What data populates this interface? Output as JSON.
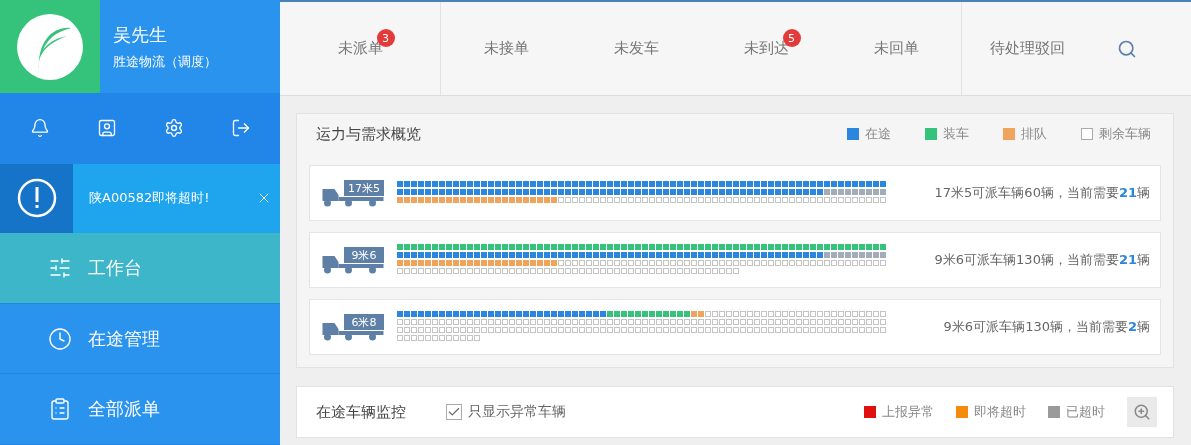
{
  "user": {
    "name": "吴先生",
    "company": "胜途物流（调度）"
  },
  "toolbar_icons": [
    {
      "kind": "bell"
    },
    {
      "kind": "contact"
    },
    {
      "kind": "settings"
    },
    {
      "kind": "logout"
    }
  ],
  "alert": {
    "text": "陕A00582即将超时!"
  },
  "menu": [
    {
      "label": "工作台",
      "selected": true
    },
    {
      "label": "在途管理",
      "selected": false
    },
    {
      "label": "全部派单",
      "selected": false
    }
  ],
  "tabs": [
    {
      "label": "未派单",
      "badge": "3"
    },
    {
      "label": "未接单"
    },
    {
      "label": "未发车"
    },
    {
      "label": "未到达",
      "badge": "5"
    },
    {
      "label": "未回单"
    },
    {
      "label": "待处理驳回"
    }
  ],
  "overview": {
    "title": "运力与需求概览",
    "legend": [
      {
        "label": "在途",
        "kind": "filled",
        "color": "#2a86de"
      },
      {
        "label": "装车",
        "kind": "filled",
        "color": "#35c27a"
      },
      {
        "label": "排队",
        "kind": "filled",
        "color": "#f0a35a"
      },
      {
        "label": "剩余车辆",
        "kind": "empty"
      }
    ],
    "rows": [
      {
        "truck": "17米5",
        "summary": "17米5可派车辆60辆，当前需要**21**辆"
      },
      {
        "truck": "9米6",
        "summary": "9米6可派车辆130辆，当前需要**21**辆"
      },
      {
        "truck": "6米8",
        "summary": "9米6可派车辆130辆，当前需要**2**辆"
      }
    ]
  },
  "monitor": {
    "title": "在途车辆监控",
    "filter": {
      "label": "只显示异常车辆",
      "checked": true
    },
    "legend": [
      {
        "label": "上报异常",
        "color": "#e01010"
      },
      {
        "label": "即将超时",
        "color": "#f68a0c"
      },
      {
        "label": "已超时",
        "color": "#9a9a9a"
      }
    ]
  }
}
